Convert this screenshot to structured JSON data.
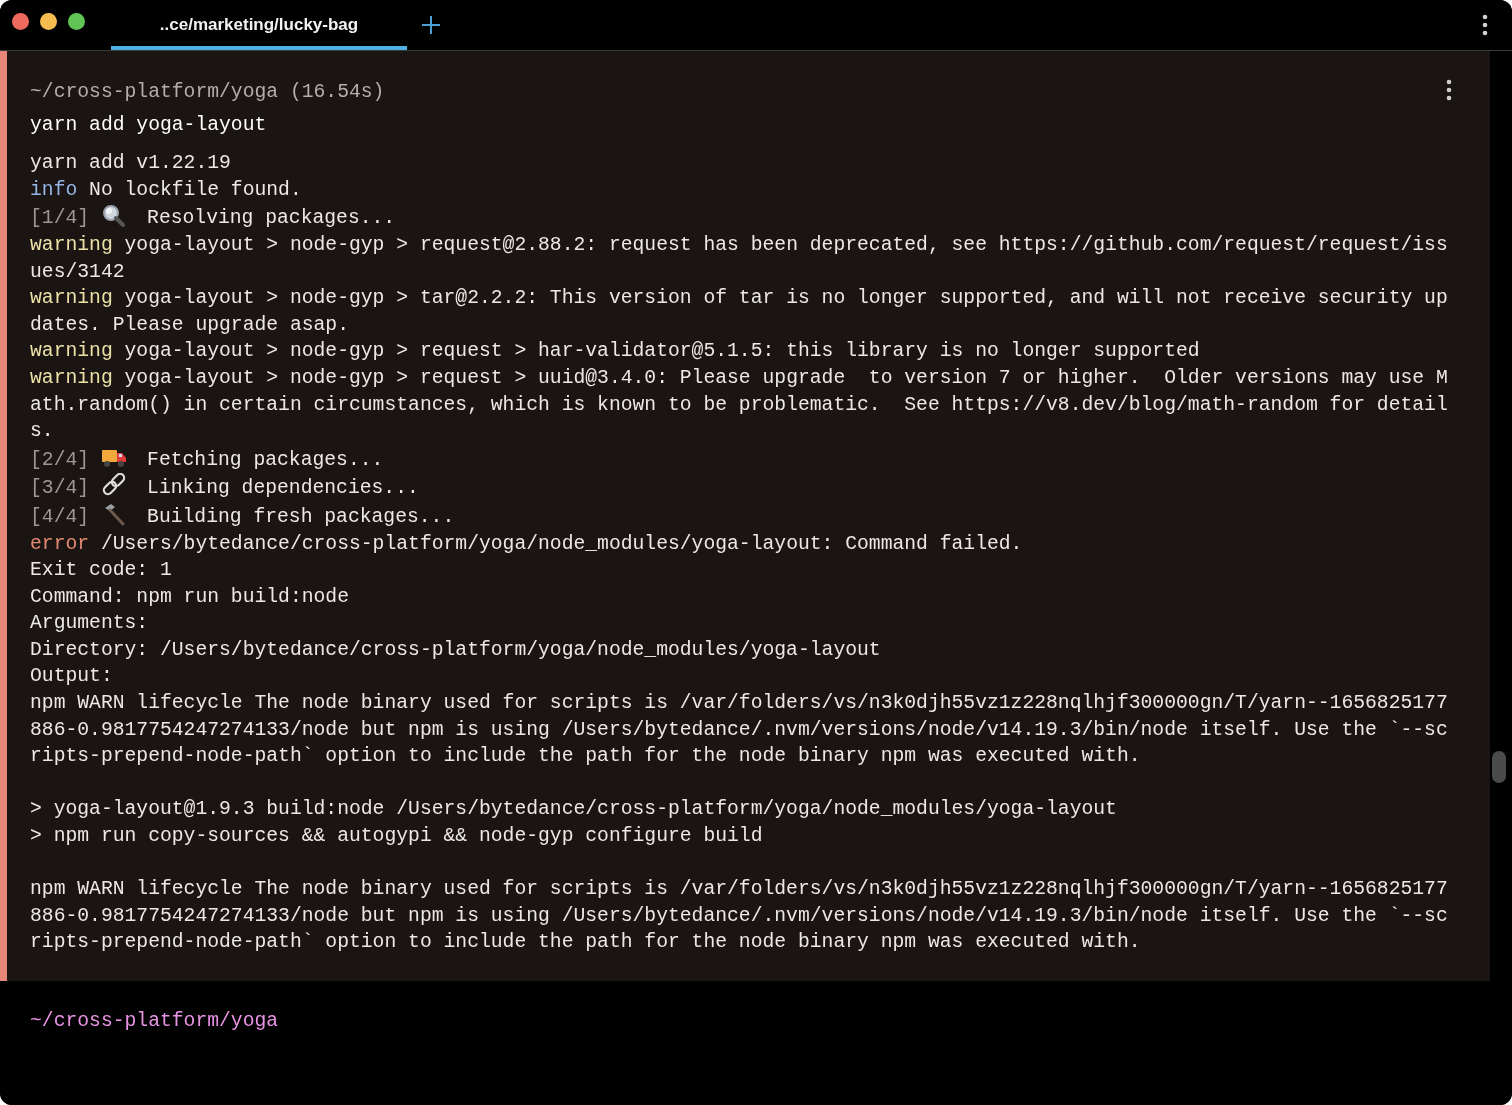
{
  "window": {
    "tabs": [
      {
        "label": "..ce/marketing/lucky-bag",
        "selected": true
      }
    ]
  },
  "block": {
    "directory": "~/cross-platform/yoga (16.54s)",
    "command": "yarn add yoga-layout",
    "failed": true,
    "output": [
      {
        "kind": "plain",
        "text": "yarn add v1.22.19"
      },
      {
        "kind": "info",
        "tag": "info",
        "text": " No lockfile found."
      },
      {
        "kind": "step",
        "tag": "[1/4]",
        "text": "Resolving packages..."
      },
      {
        "kind": "warning",
        "tag": "warning",
        "text": " yoga-layout > node-gyp > request@2.88.2: request has been deprecated, see https://github.com/request/request/iss"
      },
      {
        "kind": "plain",
        "text": "ues/3142"
      },
      {
        "kind": "warning",
        "tag": "warning",
        "text": " yoga-layout > node-gyp > tar@2.2.2: This version of tar is no longer supported, and will not receive security up"
      },
      {
        "kind": "plain",
        "text": "dates. Please upgrade asap."
      },
      {
        "kind": "warning",
        "tag": "warning",
        "text": " yoga-layout > node-gyp > request > har-validator@5.1.5: this library is no longer supported"
      },
      {
        "kind": "warning",
        "tag": "warning",
        "text": " yoga-layout > node-gyp > request > uuid@3.4.0: Please upgrade  to version 7 or higher.  Older versions may use M"
      },
      {
        "kind": "plain",
        "text": "ath.random() in certain circumstances, which is known to be problematic.  See https://v8.dev/blog/math-random for detail"
      },
      {
        "kind": "plain",
        "text": "s."
      },
      {
        "kind": "step",
        "tag": "[2/4]",
        "text": "Fetching packages..."
      },
      {
        "kind": "step",
        "tag": "[3/4]",
        "text": "Linking dependencies..."
      },
      {
        "kind": "step",
        "tag": "[4/4]",
        "text": "Building fresh packages..."
      },
      {
        "kind": "error",
        "tag": "error",
        "text": " /Users/bytedance/cross-platform/yoga/node_modules/yoga-layout: Command failed."
      },
      {
        "kind": "plain",
        "text": "Exit code: 1"
      },
      {
        "kind": "plain",
        "text": "Command: npm run build:node"
      },
      {
        "kind": "plain",
        "text": "Arguments:"
      },
      {
        "kind": "plain",
        "text": "Directory: /Users/bytedance/cross-platform/yoga/node_modules/yoga-layout"
      },
      {
        "kind": "plain",
        "text": "Output:"
      },
      {
        "kind": "plain",
        "text": "npm WARN lifecycle The node binary used for scripts is /var/folders/vs/n3k0djh55vz1z228nqlhjf300000gn/T/yarn--1656825177"
      },
      {
        "kind": "plain",
        "text": "886-0.9817754247274133/node but npm is using /Users/bytedance/.nvm/versions/node/v14.19.3/bin/node itself. Use the `--sc"
      },
      {
        "kind": "plain",
        "text": "ripts-prepend-node-path` option to include the path for the node binary npm was executed with."
      },
      {
        "kind": "blank"
      },
      {
        "kind": "plain",
        "text": "> yoga-layout@1.9.3 build:node /Users/bytedance/cross-platform/yoga/node_modules/yoga-layout"
      },
      {
        "kind": "plain",
        "text": "> npm run copy-sources && autogypi && node-gyp configure build"
      },
      {
        "kind": "blank"
      },
      {
        "kind": "plain",
        "text": "npm WARN lifecycle The node binary used for scripts is /var/folders/vs/n3k0djh55vz1z228nqlhjf300000gn/T/yarn--1656825177"
      },
      {
        "kind": "plain",
        "text": "886-0.9817754247274133/node but npm is using /Users/bytedance/.nvm/versions/node/v14.19.3/bin/node itself. Use the `--sc"
      },
      {
        "kind": "plain",
        "text": "ripts-prepend-node-path` option to include the path for the node binary npm was executed with."
      }
    ]
  },
  "prompt": {
    "directory": "~/cross-platform/yoga"
  }
}
